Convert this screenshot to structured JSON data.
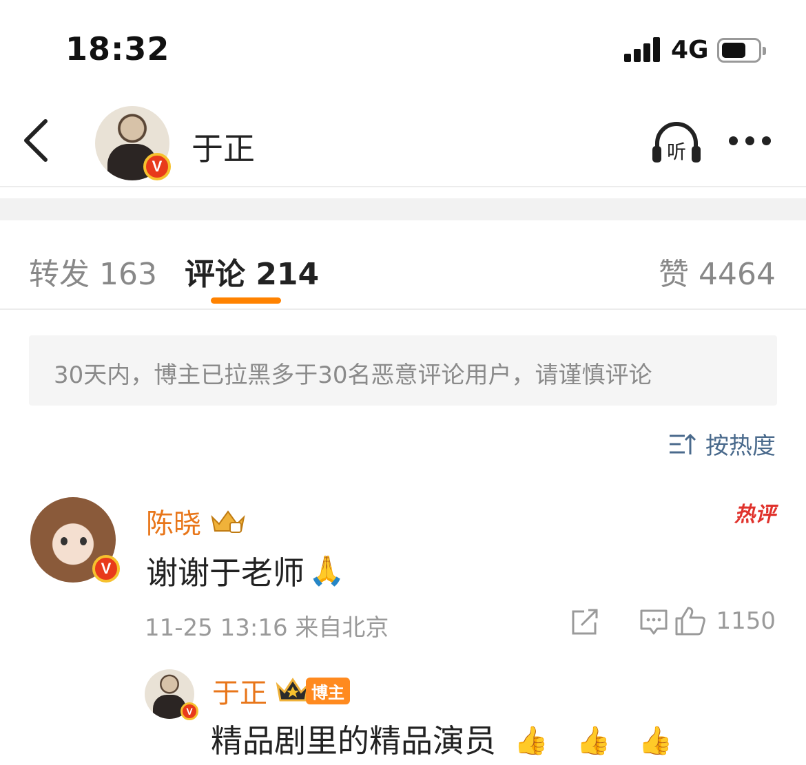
{
  "status_bar": {
    "time": "18:32",
    "network": "4G"
  },
  "header": {
    "name": "于正",
    "listen_label": "听"
  },
  "tabs": {
    "repost": "转发 163",
    "comment": "评论 214",
    "like": "赞 4464"
  },
  "notice": "30天内，博主已拉黑多于30名恶意评论用户，请谨慎评论",
  "sort_label": "按热度",
  "comment": {
    "author": "陈晓",
    "hot_tag": "热评",
    "text": "谢谢于老师",
    "emoji": "🙏",
    "meta": "11-25 13:16 来自北京",
    "likes": "1150"
  },
  "reply": {
    "author": "于正",
    "badge": "博主",
    "text": "精品剧里的精品演员",
    "emojis": [
      "👍",
      "👍",
      "👍"
    ]
  },
  "colors": {
    "accent": "#ff8200",
    "name": "#e8761a",
    "link": "#4a6a8c",
    "hot": "#e0322c"
  }
}
